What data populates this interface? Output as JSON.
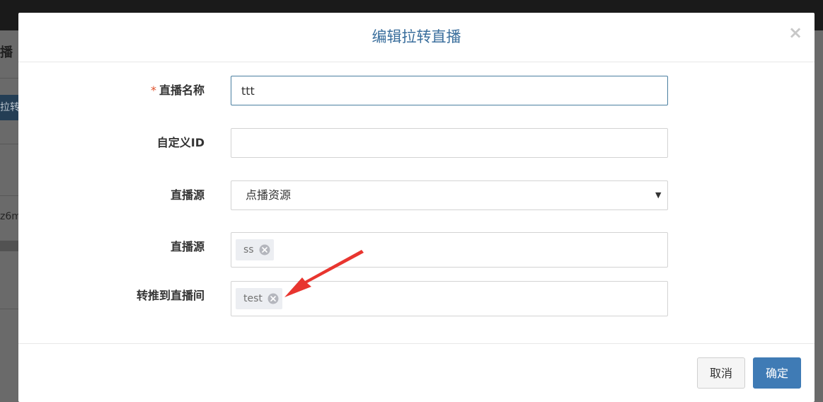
{
  "background": {
    "title_fragment": "播",
    "tab_fragment": "拉转",
    "cell_fragment": "z6m"
  },
  "modal": {
    "title": "编辑拉转直播",
    "close_glyph": "×",
    "fields": {
      "name": {
        "required_mark": "*",
        "label": "直播名称",
        "value": "ttt"
      },
      "custom_id": {
        "label": "自定义ID",
        "value": "",
        "placeholder": ""
      },
      "source_type": {
        "label": "直播源",
        "selected": "点播资源"
      },
      "source": {
        "label": "直播源",
        "tags": [
          "ss"
        ]
      },
      "push_to_room": {
        "label": "转推到直播间",
        "tags": [
          "test"
        ]
      }
    },
    "footer": {
      "cancel_label": "取消",
      "ok_label": "确定"
    }
  },
  "annotation": {
    "color": "#e8352f"
  },
  "colors": {
    "title": "#3a6e9c",
    "primary_button": "#3f7bb5",
    "required": "#e0522c",
    "focus_border": "#4a7fa0"
  }
}
